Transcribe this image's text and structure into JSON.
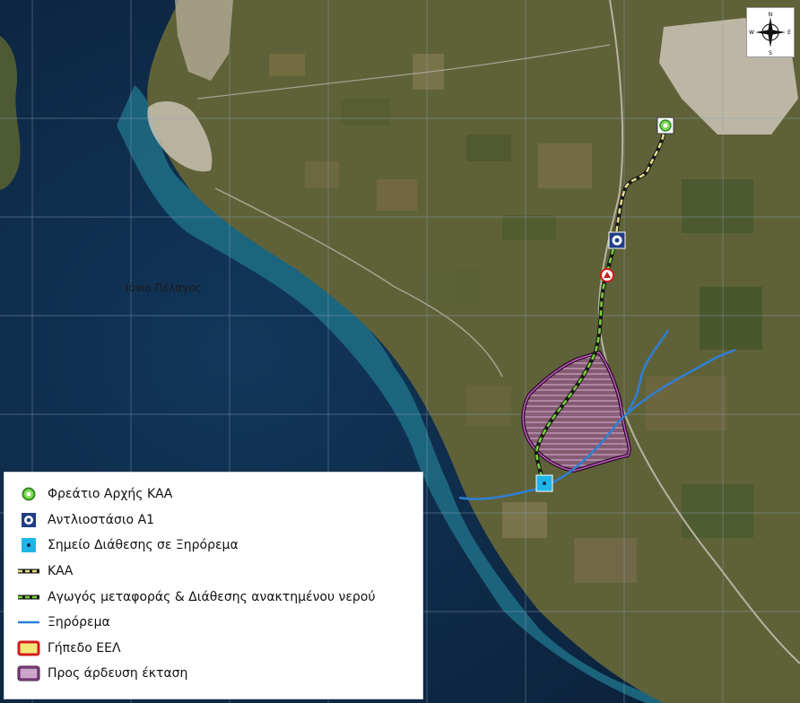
{
  "map": {
    "sea_label": "Ιόνιο Πέλαγος",
    "compass": {
      "north": "N",
      "south": "S",
      "east": "E",
      "west": "W"
    },
    "colors": {
      "sea_deep": "#0d2742",
      "sea_shallow": "#1d6d83",
      "land": "#6b6a3a",
      "kaa_line": "#e6e08a",
      "transport_line": "#78d23a",
      "stream": "#2f7fd6",
      "irrigation_area": "#a455a0",
      "wwtp": "#d51c1c"
    }
  },
  "legend": {
    "items": [
      {
        "label": "Φρεάτιο Αρχής ΚΑΑ",
        "symbol": "green-circle-icon"
      },
      {
        "label": "Αντλιοστάσιο Α1",
        "symbol": "pump-station-icon"
      },
      {
        "label": "Σημείο Διάθεσης σε Ξηρόρεμα",
        "symbol": "discharge-point-icon"
      },
      {
        "label": "ΚΑΑ",
        "symbol": "kaa-line-icon"
      },
      {
        "label": "Αγωγός μεταφοράς & Διάθεσης ανακτημένου νερού",
        "symbol": "transport-pipe-line-icon"
      },
      {
        "label": "Ξηρόρεμα",
        "symbol": "stream-line-icon"
      },
      {
        "label": "Γήπεδο ΕΕΛ",
        "symbol": "wwtp-plot-icon"
      },
      {
        "label": "Προς άρδευση έκταση",
        "symbol": "irrigation-area-icon"
      }
    ]
  }
}
